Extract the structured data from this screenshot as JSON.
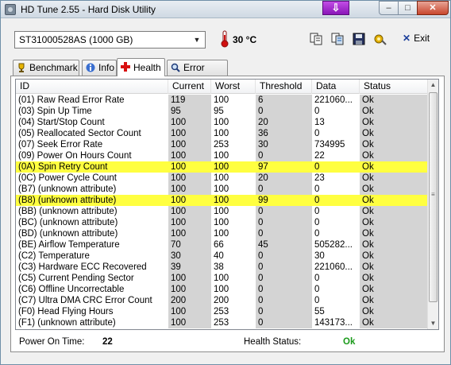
{
  "window": {
    "title": "HD Tune 2.55 - Hard Disk Utility"
  },
  "toolbar": {
    "drive": "ST31000528AS (1000 GB)",
    "temperature": "30 °C",
    "exit_label": "Exit"
  },
  "tabs": [
    {
      "label": "Benchmark"
    },
    {
      "label": "Info"
    },
    {
      "label": "Health"
    },
    {
      "label": "Error Scan"
    }
  ],
  "table": {
    "headers": [
      "ID",
      "Current",
      "Worst",
      "Threshold",
      "Data",
      "Status"
    ],
    "rows": [
      {
        "id": "(01) Raw Read Error Rate",
        "current": "119",
        "worst": "100",
        "threshold": "6",
        "data": "221060...",
        "status": "Ok",
        "highlight": false
      },
      {
        "id": "(03) Spin Up Time",
        "current": "95",
        "worst": "95",
        "threshold": "0",
        "data": "0",
        "status": "Ok",
        "highlight": false
      },
      {
        "id": "(04) Start/Stop Count",
        "current": "100",
        "worst": "100",
        "threshold": "20",
        "data": "13",
        "status": "Ok",
        "highlight": false
      },
      {
        "id": "(05) Reallocated Sector Count",
        "current": "100",
        "worst": "100",
        "threshold": "36",
        "data": "0",
        "status": "Ok",
        "highlight": false
      },
      {
        "id": "(07) Seek Error Rate",
        "current": "100",
        "worst": "253",
        "threshold": "30",
        "data": "734995",
        "status": "Ok",
        "highlight": false
      },
      {
        "id": "(09) Power On Hours Count",
        "current": "100",
        "worst": "100",
        "threshold": "0",
        "data": "22",
        "status": "Ok",
        "highlight": false
      },
      {
        "id": "(0A) Spin Retry Count",
        "current": "100",
        "worst": "100",
        "threshold": "97",
        "data": "0",
        "status": "Ok",
        "highlight": true
      },
      {
        "id": "(0C) Power Cycle Count",
        "current": "100",
        "worst": "100",
        "threshold": "20",
        "data": "23",
        "status": "Ok",
        "highlight": false
      },
      {
        "id": "(B7) (unknown attribute)",
        "current": "100",
        "worst": "100",
        "threshold": "0",
        "data": "0",
        "status": "Ok",
        "highlight": false
      },
      {
        "id": "(B8) (unknown attribute)",
        "current": "100",
        "worst": "100",
        "threshold": "99",
        "data": "0",
        "status": "Ok",
        "highlight": true
      },
      {
        "id": "(BB) (unknown attribute)",
        "current": "100",
        "worst": "100",
        "threshold": "0",
        "data": "0",
        "status": "Ok",
        "highlight": false
      },
      {
        "id": "(BC) (unknown attribute)",
        "current": "100",
        "worst": "100",
        "threshold": "0",
        "data": "0",
        "status": "Ok",
        "highlight": false
      },
      {
        "id": "(BD) (unknown attribute)",
        "current": "100",
        "worst": "100",
        "threshold": "0",
        "data": "0",
        "status": "Ok",
        "highlight": false
      },
      {
        "id": "(BE) Airflow Temperature",
        "current": "70",
        "worst": "66",
        "threshold": "45",
        "data": "505282...",
        "status": "Ok",
        "highlight": false
      },
      {
        "id": "(C2) Temperature",
        "current": "30",
        "worst": "40",
        "threshold": "0",
        "data": "30",
        "status": "Ok",
        "highlight": false
      },
      {
        "id": "(C3) Hardware ECC Recovered",
        "current": "39",
        "worst": "38",
        "threshold": "0",
        "data": "221060...",
        "status": "Ok",
        "highlight": false
      },
      {
        "id": "(C5) Current Pending Sector",
        "current": "100",
        "worst": "100",
        "threshold": "0",
        "data": "0",
        "status": "Ok",
        "highlight": false
      },
      {
        "id": "(C6) Offline Uncorrectable",
        "current": "100",
        "worst": "100",
        "threshold": "0",
        "data": "0",
        "status": "Ok",
        "highlight": false
      },
      {
        "id": "(C7) Ultra DMA CRC Error Count",
        "current": "200",
        "worst": "200",
        "threshold": "0",
        "data": "0",
        "status": "Ok",
        "highlight": false
      },
      {
        "id": "(F0) Head Flying Hours",
        "current": "100",
        "worst": "253",
        "threshold": "0",
        "data": "55",
        "status": "Ok",
        "highlight": false
      },
      {
        "id": "(F1) (unknown attribute)",
        "current": "100",
        "worst": "253",
        "threshold": "0",
        "data": "143173...",
        "status": "Ok",
        "highlight": false
      }
    ]
  },
  "footer": {
    "power_on_label": "Power On Time:",
    "power_on_value": "22",
    "health_label": "Health Status:",
    "health_value": "Ok"
  },
  "colors": {
    "highlight": "#ffff40",
    "health_ok": "#1a9a1a",
    "temp_red": "#d01010"
  }
}
